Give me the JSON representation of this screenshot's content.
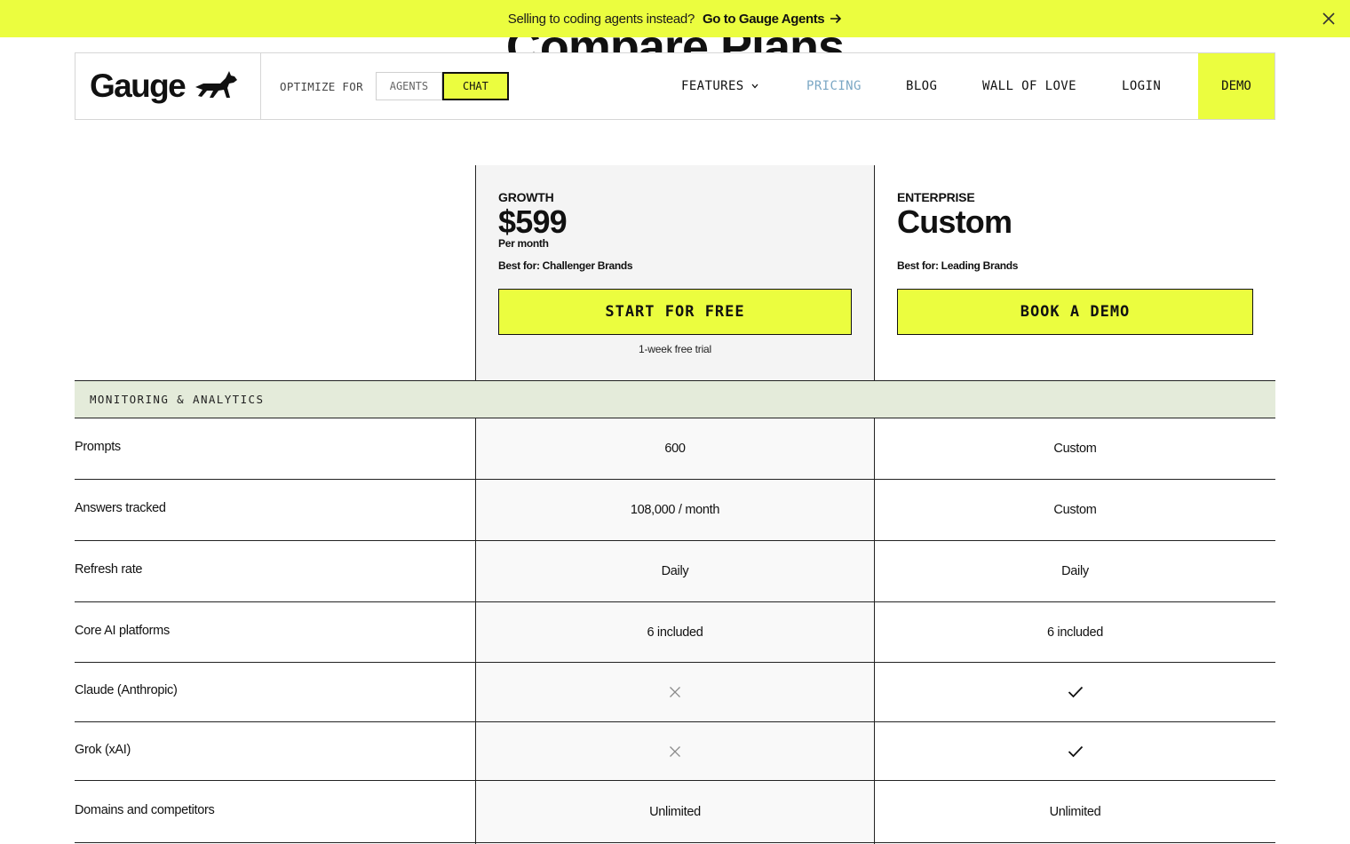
{
  "banner": {
    "message": "Selling to coding agents instead?",
    "link": "Go to Gauge Agents"
  },
  "hero": {
    "title": "Compare Plans"
  },
  "nav": {
    "logo": "Gauge",
    "optimize_label": "OPTIMIZE FOR",
    "options": [
      "AGENTS",
      "CHAT"
    ],
    "selected_option": "CHAT",
    "links": {
      "features": "FEATURES",
      "pricing": "PRICING",
      "blog": "BLOG",
      "wall": "WALL OF LOVE",
      "login": "LOGIN"
    },
    "demo": "DEMO",
    "active_link": "PRICING"
  },
  "plans": {
    "growth": {
      "name": "GROWTH",
      "price": "$599",
      "period": "Per month",
      "best_for": "Best for: Challenger Brands",
      "cta": "START FOR FREE",
      "note": "1-week free trial"
    },
    "enterprise": {
      "name": "ENTERPRISE",
      "price": "Custom",
      "best_for": "Best for: Leading Brands",
      "cta": "BOOK A DEMO"
    }
  },
  "section": {
    "title": "MONITORING & ANALYTICS"
  },
  "rows": [
    {
      "feature": "Prompts",
      "growth": "600",
      "enterprise": "Custom"
    },
    {
      "feature": "Answers tracked",
      "growth": "108,000 / month",
      "enterprise": "Custom"
    },
    {
      "feature": "Refresh rate",
      "growth": "Daily",
      "enterprise": "Daily"
    },
    {
      "feature": "Core AI platforms",
      "growth": "6 included",
      "enterprise": "6 included"
    },
    {
      "feature": "Claude (Anthropic)",
      "growth_icon": "x-icon",
      "enterprise_icon": "check-icon"
    },
    {
      "feature": "Grok (xAI)",
      "growth_icon": "x-icon",
      "enterprise_icon": "check-icon"
    },
    {
      "feature": "Domains and competitors",
      "growth": "Unlimited",
      "enterprise": "Unlimited"
    }
  ],
  "colors": {
    "accent": "#ebfd3f",
    "section_bg": "#e4ebda",
    "pricing_link": "#7ba7c4",
    "growth_col_bg": "#f4f4f4"
  }
}
